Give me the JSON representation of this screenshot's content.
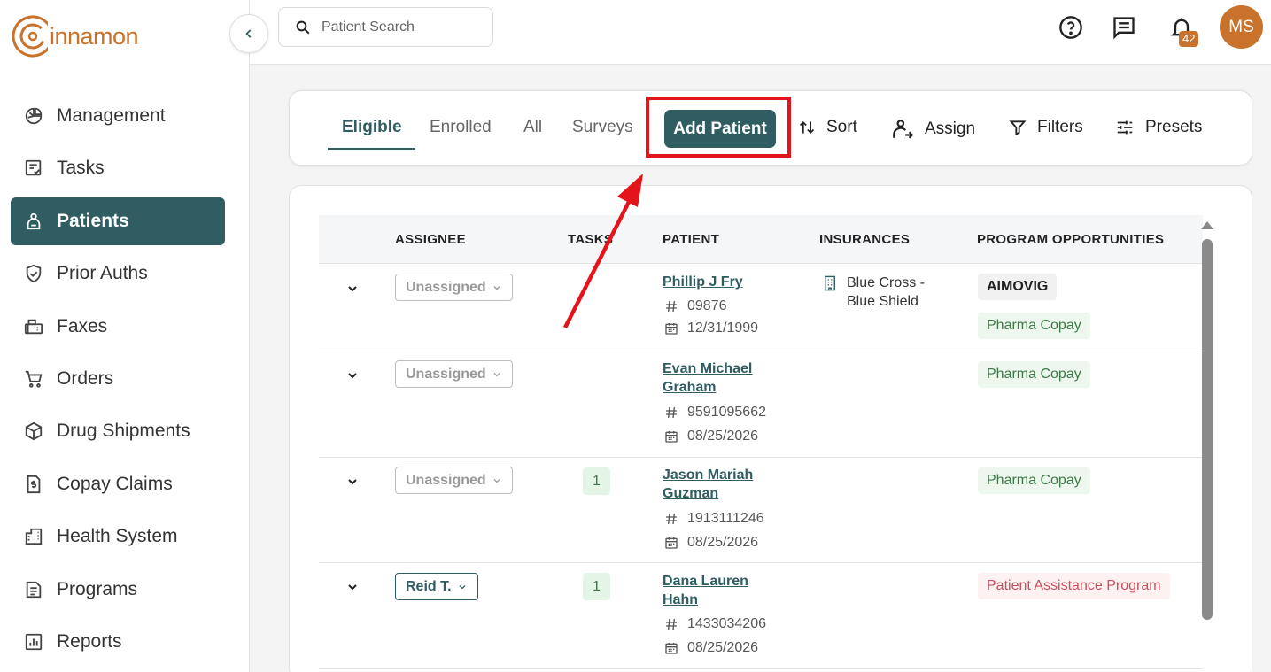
{
  "app": {
    "logo_text": "innamon"
  },
  "sidebar": {
    "items": [
      {
        "label": "Management",
        "icon": "pie-chart-icon"
      },
      {
        "label": "Tasks",
        "icon": "task-list-icon"
      },
      {
        "label": "Patients",
        "icon": "patient-icon",
        "active": true
      },
      {
        "label": "Prior Auths",
        "icon": "shield-check-icon"
      },
      {
        "label": "Faxes",
        "icon": "fax-icon"
      },
      {
        "label": "Orders",
        "icon": "cart-icon"
      },
      {
        "label": "Drug Shipments",
        "icon": "package-icon"
      },
      {
        "label": "Copay Claims",
        "icon": "dollar-document-icon"
      },
      {
        "label": "Health System",
        "icon": "building-icon"
      },
      {
        "label": "Programs",
        "icon": "document-icon"
      },
      {
        "label": "Reports",
        "icon": "bar-chart-icon"
      }
    ]
  },
  "topbar": {
    "search_placeholder": "Patient Search",
    "notification_count": "42",
    "avatar_initials": "MS"
  },
  "toolbar": {
    "tabs": [
      "Eligible",
      "Enrolled",
      "All",
      "Surveys"
    ],
    "active_tab": "Eligible",
    "add_patient_label": "Add Patient",
    "sort_label": "Sort",
    "assign_label": "Assign",
    "filters_label": "Filters",
    "presets_label": "Presets"
  },
  "table": {
    "columns": [
      "ASSIGNEE",
      "TASKS",
      "PATIENT",
      "INSURANCES",
      "PROGRAM OPPORTUNITIES"
    ],
    "rows": [
      {
        "assignee": "Unassigned",
        "tasks": "",
        "name": "Phillip J Fry",
        "id": "09876",
        "dob": "12/31/1999",
        "insurance_line1": "Blue Cross -",
        "insurance_line2": "Blue Shield",
        "programs": [
          {
            "label": "AIMOVIG",
            "style": "gray"
          },
          {
            "label": "Pharma Copay",
            "style": "green"
          }
        ]
      },
      {
        "assignee": "Unassigned",
        "tasks": "",
        "name_line1": "Evan Michael",
        "name_line2": "Graham",
        "id": "9591095662",
        "dob": "08/25/2026",
        "programs": [
          {
            "label": "Pharma Copay",
            "style": "green"
          }
        ]
      },
      {
        "assignee": "Unassigned",
        "tasks": "1",
        "name_line1": "Jason Mariah",
        "name_line2": "Guzman",
        "id": "1913111246",
        "dob": "08/25/2026",
        "programs": [
          {
            "label": "Pharma Copay",
            "style": "green"
          }
        ]
      },
      {
        "assignee": "Reid T.",
        "tasks": "1",
        "name_line1": "Dana Lauren",
        "name_line2": "Hahn",
        "id": "1433034206",
        "dob": "08/25/2026",
        "programs": [
          {
            "label": "Patient Assistance Program",
            "style": "red"
          }
        ]
      }
    ]
  },
  "colors": {
    "brand": "#c8722c",
    "primary": "#2f5d62",
    "annotation": "#e3151a"
  }
}
